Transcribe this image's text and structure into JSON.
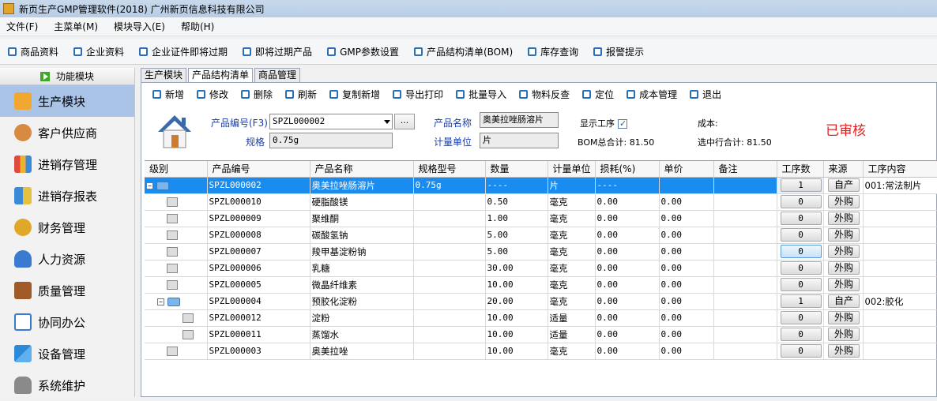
{
  "window": {
    "title": "新页生产GMP管理软件(2018) 广州新页信息科技有限公司"
  },
  "menu": [
    "文件(F)",
    "主菜单(M)",
    "模块导入(E)",
    "帮助(H)"
  ],
  "quickbar": [
    "商品资料",
    "企业资料",
    "企业证件即将过期",
    "即将过期产品",
    "GMP参数设置",
    "产品结构清单(BOM)",
    "库存查询",
    "报警提示"
  ],
  "sidebar": {
    "header": "功能模块",
    "items": [
      "生产模块",
      "客户供应商",
      "进销存管理",
      "进销存报表",
      "财务管理",
      "人力资源",
      "质量管理",
      "协同办公",
      "设备管理",
      "系统维护"
    ]
  },
  "tabs": [
    "生产模块",
    "产品结构清单",
    "商品管理"
  ],
  "toolbar": [
    "新增",
    "修改",
    "删除",
    "刷新",
    "复制新增",
    "导出打印",
    "批量导入",
    "物料反查",
    "定位",
    "成本管理",
    "退出"
  ],
  "form": {
    "code_label": "产品编号(F3)",
    "code_value": "SPZL000002",
    "browse_btn": "...",
    "spec_label": "规格",
    "spec_value": "0.75g",
    "name_label": "产品名称",
    "name_value": "奥美拉唑肠溶片",
    "unit_label": "计量单位",
    "unit_value": "片",
    "show_process_label": "显示工序",
    "bom_total": "BOM总合计: 81.50",
    "cost_label": "成本:",
    "selected_total": "选中行合计: 81.50",
    "status": "已审核"
  },
  "grid": {
    "columns": [
      "级别",
      "产品编号",
      "产品名称",
      "规格型号",
      "数量",
      "计量单位",
      "损耗(%)",
      "单价",
      "备注",
      "工序数",
      "来源",
      "工序内容"
    ],
    "rows": [
      {
        "code": "SPZL000002",
        "name": "奥美拉唑肠溶片",
        "spec": "0.75g",
        "qty": "----",
        "unit": "片",
        "loss": "----",
        "price": "",
        "proc": "1",
        "src": "自产",
        "content": "001:常法制片"
      },
      {
        "code": "SPZL000010",
        "name": "硬脂酸镁",
        "spec": "",
        "qty": "0.50",
        "unit": "毫克",
        "loss": "0.00",
        "price": "0.00",
        "proc": "0",
        "src": "外购",
        "content": ""
      },
      {
        "code": "SPZL000009",
        "name": "聚维酮",
        "spec": "",
        "qty": "1.00",
        "unit": "毫克",
        "loss": "0.00",
        "price": "0.00",
        "proc": "0",
        "src": "外购",
        "content": ""
      },
      {
        "code": "SPZL000008",
        "name": "碳酸氢钠",
        "spec": "",
        "qty": "5.00",
        "unit": "毫克",
        "loss": "0.00",
        "price": "0.00",
        "proc": "0",
        "src": "外购",
        "content": ""
      },
      {
        "code": "SPZL000007",
        "name": "羧甲基淀粉钠",
        "spec": "",
        "qty": "5.00",
        "unit": "毫克",
        "loss": "0.00",
        "price": "0.00",
        "proc": "0",
        "src": "外购",
        "content": ""
      },
      {
        "code": "SPZL000006",
        "name": "乳糖",
        "spec": "",
        "qty": "30.00",
        "unit": "毫克",
        "loss": "0.00",
        "price": "0.00",
        "proc": "0",
        "src": "外购",
        "content": ""
      },
      {
        "code": "SPZL000005",
        "name": "微晶纤维素",
        "spec": "",
        "qty": "10.00",
        "unit": "毫克",
        "loss": "0.00",
        "price": "0.00",
        "proc": "0",
        "src": "外购",
        "content": ""
      },
      {
        "code": "SPZL000004",
        "name": "预胶化淀粉",
        "spec": "",
        "qty": "20.00",
        "unit": "毫克",
        "loss": "0.00",
        "price": "0.00",
        "proc": "1",
        "src": "自产",
        "content": "002:胶化"
      },
      {
        "code": "SPZL000012",
        "name": "淀粉",
        "spec": "",
        "qty": "10.00",
        "unit": "适量",
        "loss": "0.00",
        "price": "0.00",
        "proc": "0",
        "src": "外购",
        "content": ""
      },
      {
        "code": "SPZL000011",
        "name": "蒸馏水",
        "spec": "",
        "qty": "10.00",
        "unit": "适量",
        "loss": "0.00",
        "price": "0.00",
        "proc": "0",
        "src": "外购",
        "content": ""
      },
      {
        "code": "SPZL000003",
        "name": "奥美拉唑",
        "spec": "",
        "qty": "10.00",
        "unit": "毫克",
        "loss": "0.00",
        "price": "0.00",
        "proc": "0",
        "src": "外购",
        "content": ""
      }
    ]
  }
}
